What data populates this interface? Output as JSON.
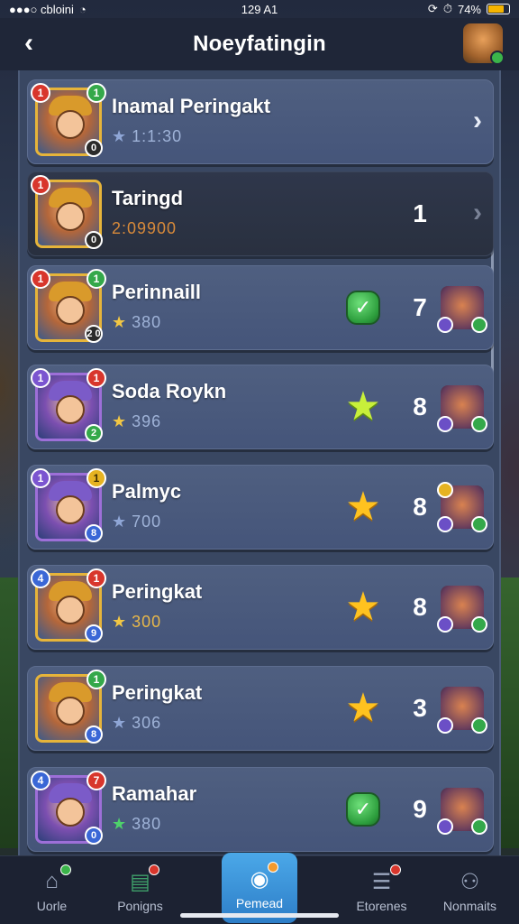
{
  "status_bar": {
    "carrier": "●●●○ cbloini",
    "time": "129 A1",
    "battery": "74%"
  },
  "header": {
    "title": "Noeyfatingin"
  },
  "rows": [
    {
      "name": "Inamal Peringakt",
      "score": "1:1:30",
      "rank": "",
      "badge_tl": "1",
      "badge_tr": "1",
      "badge_br": "0",
      "status": "none",
      "style": "light",
      "star": "blue"
    },
    {
      "name": "Taringd",
      "score": "2:09900",
      "rank": "1",
      "badge_tl": "1",
      "badge_tr": "",
      "badge_br": "0",
      "status": "none",
      "style": "dark",
      "star": ""
    },
    {
      "name": "Perinnaill",
      "score": "380",
      "rank": "7",
      "badge_tl": "1",
      "badge_tr": "1",
      "badge_br": "2 0",
      "status": "check",
      "style": "light",
      "star": "gold"
    },
    {
      "name": "Soda Roykn",
      "score": "396",
      "rank": "8",
      "badge_tl": "1",
      "badge_tr": "1",
      "badge_br": "2",
      "status": "lime-star",
      "style": "light",
      "star": "gold"
    },
    {
      "name": "Palmyc",
      "score": "700",
      "rank": "8",
      "badge_tl": "1",
      "badge_tr": "1",
      "badge_br": "8",
      "status": "gold-star",
      "style": "light",
      "star": "blue"
    },
    {
      "name": "Peringkat",
      "score": "300",
      "rank": "8",
      "badge_tl": "4",
      "badge_tr": "1",
      "badge_br": "9",
      "status": "gold-star",
      "style": "light",
      "star": "gold"
    },
    {
      "name": "Peringkat",
      "score": "306",
      "rank": "3",
      "badge_tl": "",
      "badge_tr": "1",
      "badge_br": "8",
      "status": "gold-star",
      "style": "light",
      "star": "blue"
    },
    {
      "name": "Ramahar",
      "score": "380",
      "rank": "9",
      "badge_tl": "4",
      "badge_tr": "7",
      "badge_br": "0",
      "status": "check",
      "style": "light",
      "star": "green"
    }
  ],
  "bottom_nav": {
    "items": [
      {
        "label": "Uorle",
        "icon": "house-icon"
      },
      {
        "label": "Ponigns",
        "icon": "chest-icon"
      },
      {
        "label": "Pemead",
        "icon": "camera-icon"
      },
      {
        "label": "Etorenes",
        "icon": "list-icon"
      },
      {
        "label": "Nonmaits",
        "icon": "person-icon"
      }
    ],
    "active_index": 2
  },
  "colors": {
    "accent": "#2d7ec8",
    "gold": "#ffc21f",
    "green": "#34a84a",
    "red": "#d8362c"
  }
}
